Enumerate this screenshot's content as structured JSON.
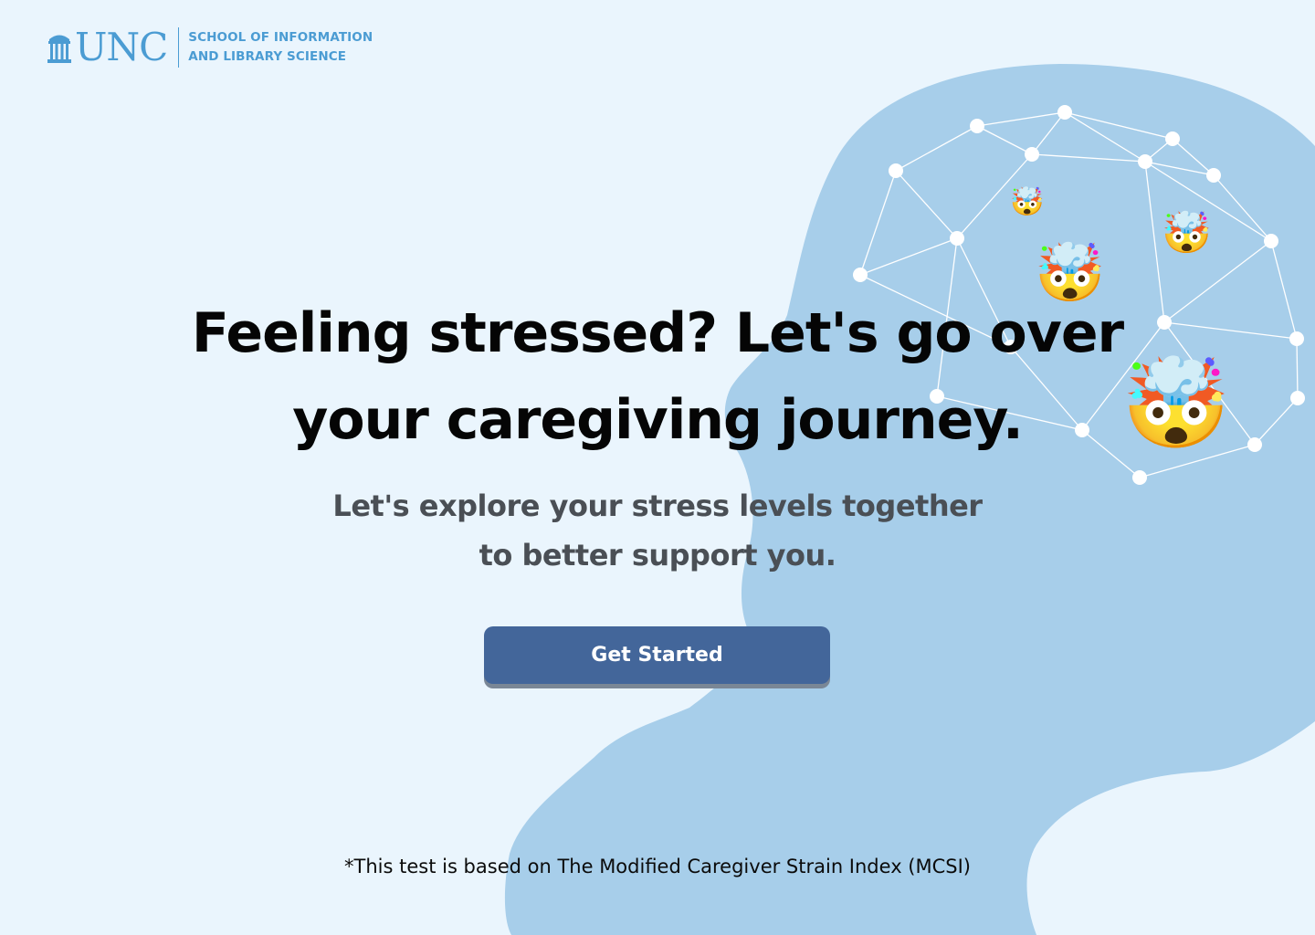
{
  "brand": {
    "wordmark": "UNC",
    "school_line1": "SCHOOL OF INFORMATION",
    "school_line2": "AND LIBRARY SCIENCE",
    "color": "#4B9CD3"
  },
  "hero": {
    "headline_line1": "Feeling stressed? Let's go over",
    "headline_line2": "your caregiving journey.",
    "subhead_line1": "Let's explore your stress levels together",
    "subhead_line2": "to better support you."
  },
  "cta": {
    "label": "Get Started",
    "color": "#43669A"
  },
  "footnote": "*This test is based on The Modified Caregiver Strain Index (MCSI)",
  "illustration": {
    "subject": "head silhouette with brain network",
    "icon": "exploding-head-emoji",
    "emoji_char": "🤯",
    "silhouette_color": "#A7CEEA",
    "background_color": "#EAF5FD"
  }
}
